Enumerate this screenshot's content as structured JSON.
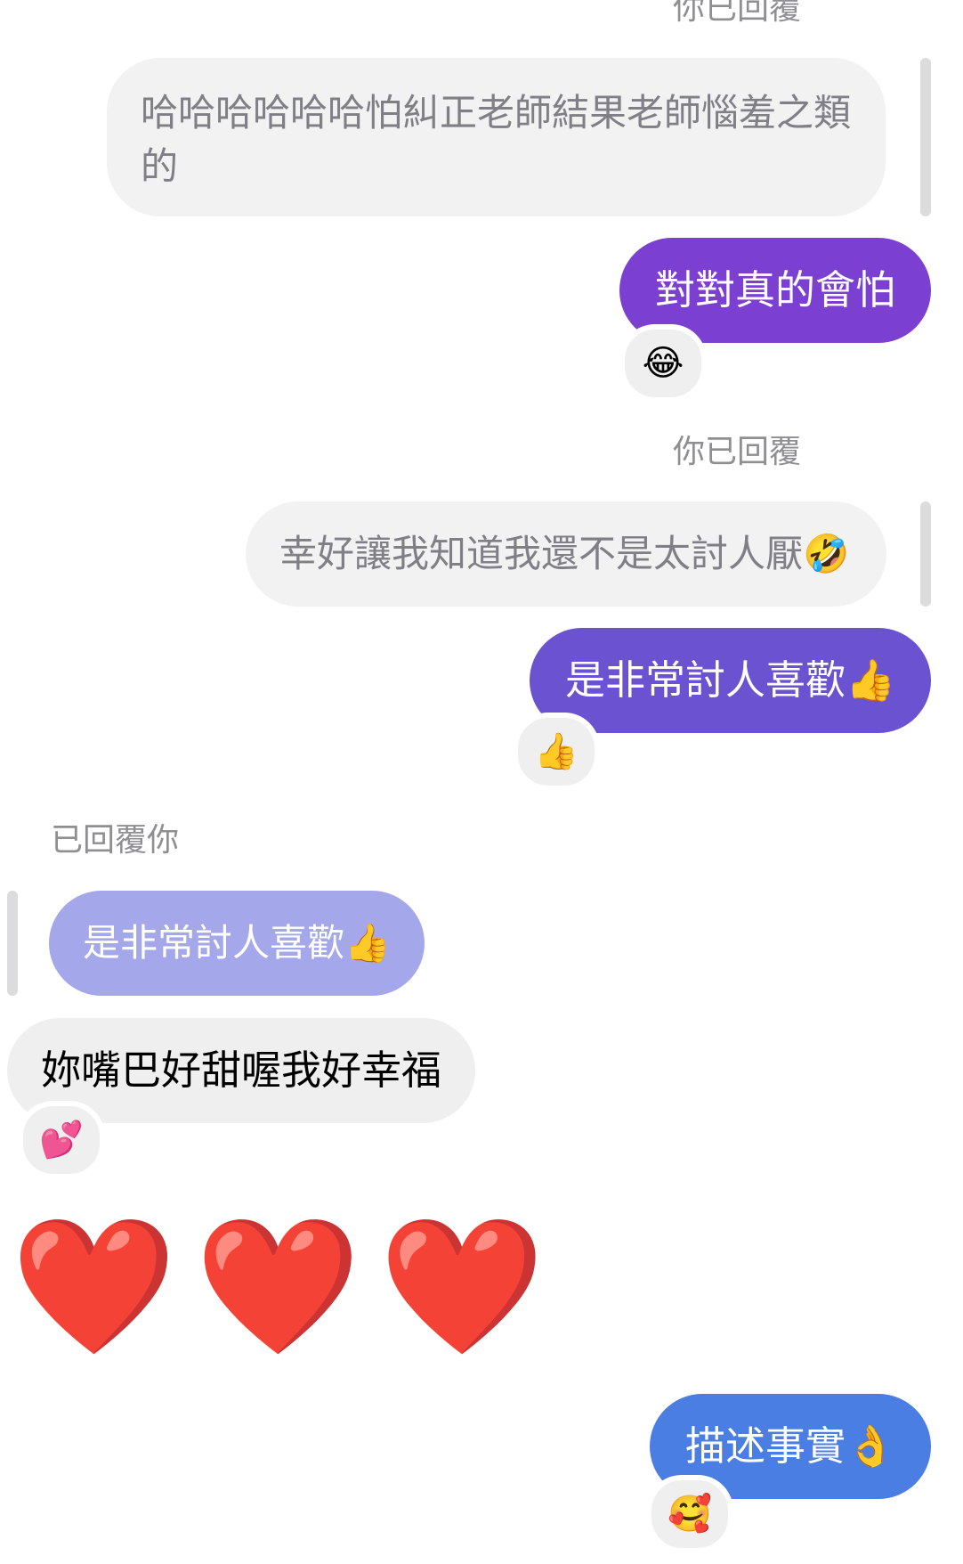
{
  "messages": {
    "m1": {
      "reply_caption": "你已回覆",
      "quoted_text": "哈哈哈哈哈哈怕糾正老師結果老師惱羞之類的",
      "text": "對對真的會怕",
      "reaction": "😂",
      "color": "#7b3fd1"
    },
    "m2": {
      "reply_caption": "你已回覆",
      "quoted_text": "幸好讓我知道我還不是太討人厭🤣",
      "text": "是非常討人喜歡👍",
      "reaction": "👍",
      "color": "#6a52d0"
    },
    "m3": {
      "reply_caption": "已回覆你",
      "quoted_text": "是非常討人喜歡👍",
      "text": "妳嘴巴好甜喔我好幸福",
      "reaction": "💕"
    },
    "m4": {
      "hearts": [
        "❤️",
        "❤️",
        "❤️"
      ]
    },
    "m5": {
      "text": "描述事實👌",
      "reaction": "🥰",
      "color": "#4a7ee3"
    }
  }
}
